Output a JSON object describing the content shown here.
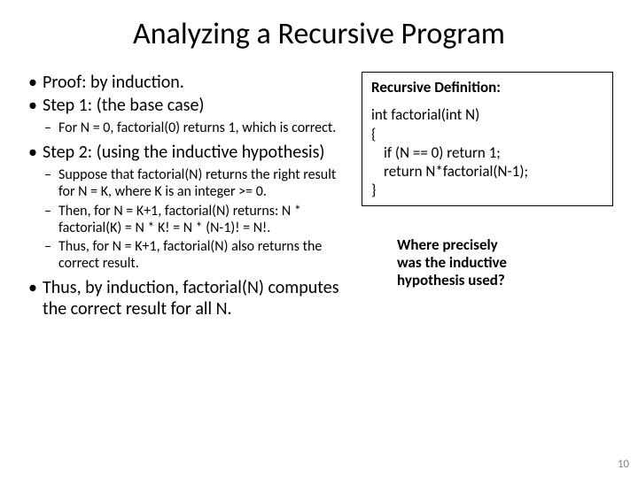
{
  "title": "Analyzing a Recursive Program",
  "left": {
    "b1": "Proof: by induction.",
    "b2": "Step 1: (the base case)",
    "s2a": "For N = 0, factorial(0) returns 1, which is correct.",
    "b3": "Step 2: (using the inductive hypothesis)",
    "s3a": "Suppose that factorial(N) returns the right result for N = K, where K is an integer >= 0.",
    "s3b": "Then, for N = K+1, factorial(N) returns: N * factorial(K) = N * K! = N * (N-1)! = N!.",
    "s3c": "Thus, for N = K+1, factorial(N) also returns the correct result.",
    "b4": "Thus, by induction, factorial(N) computes the correct result for all N."
  },
  "code": {
    "heading": "Recursive  Definition:",
    "l1": "int factorial(int N)",
    "l2": "{",
    "l3": "if (N == 0) return 1;",
    "l4": "return N*factorial(N-1);",
    "l5": "}"
  },
  "question": {
    "l1": "Where precisely",
    "l2": "was the inductive",
    "l3": "hypothesis used?"
  },
  "pagenum": "10"
}
